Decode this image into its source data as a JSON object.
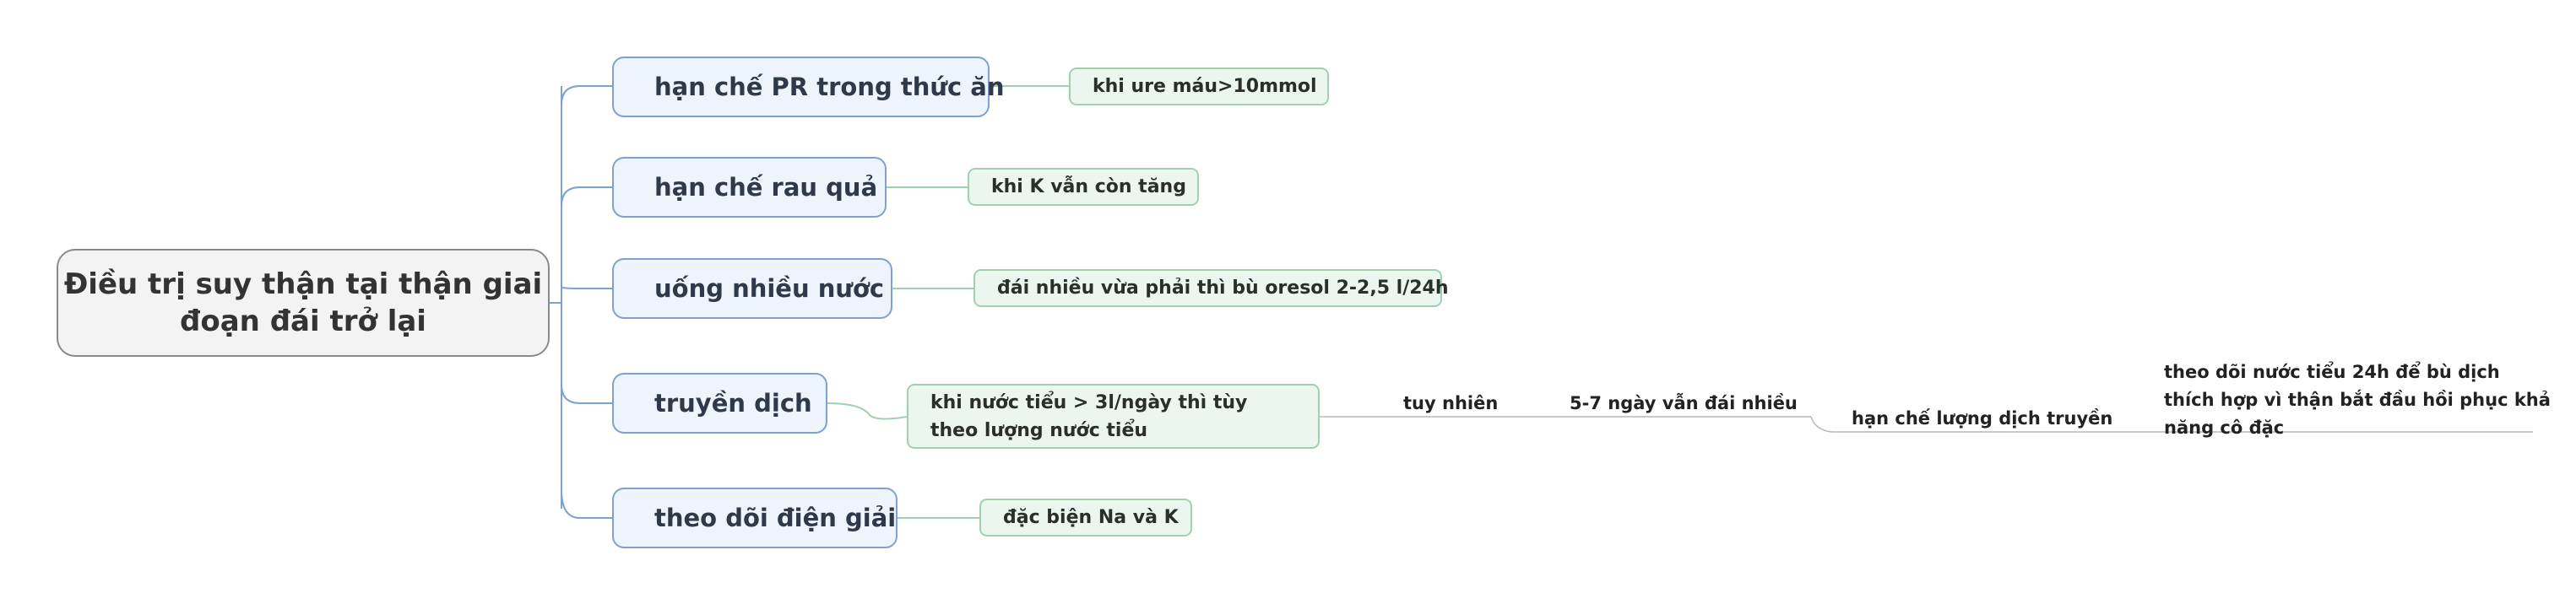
{
  "root": {
    "label": "Điều trị suy thận tại thận giai đoạn đái trở lại"
  },
  "topics": [
    {
      "label": "hạn chế PR trong thức ăn",
      "detail": "khi ure máu>10mmol"
    },
    {
      "label": "hạn chế rau quả",
      "detail": "khi K vẫn còn tăng"
    },
    {
      "label": "uống nhiều nước",
      "detail": "đái nhiều vừa phải thì bù oresol 2-2,5 l/24h"
    },
    {
      "label": "truyền dịch",
      "detail": "khi nước tiểu > 3l/ngày thì tùy theo lượng nước tiểu"
    },
    {
      "label": "theo dõi điện giải",
      "detail": "đặc biện Na và K"
    }
  ],
  "chain": [
    "tuy nhiên",
    "5-7 ngày vẫn đái nhiều",
    "hạn chế lượng dịch truyền",
    "theo dõi nước tiểu 24h để bù dịch thích hợp vì thận bắt đầu hồi phục khả năng cô đặc"
  ],
  "colors": {
    "root_border": "#8a8a8a",
    "topic_border": "#7da2cf",
    "topic_fill": "#eef4fb",
    "detail_border": "#9fd0b0",
    "detail_fill": "#eaf6ee",
    "connector": "#7da2cf"
  }
}
